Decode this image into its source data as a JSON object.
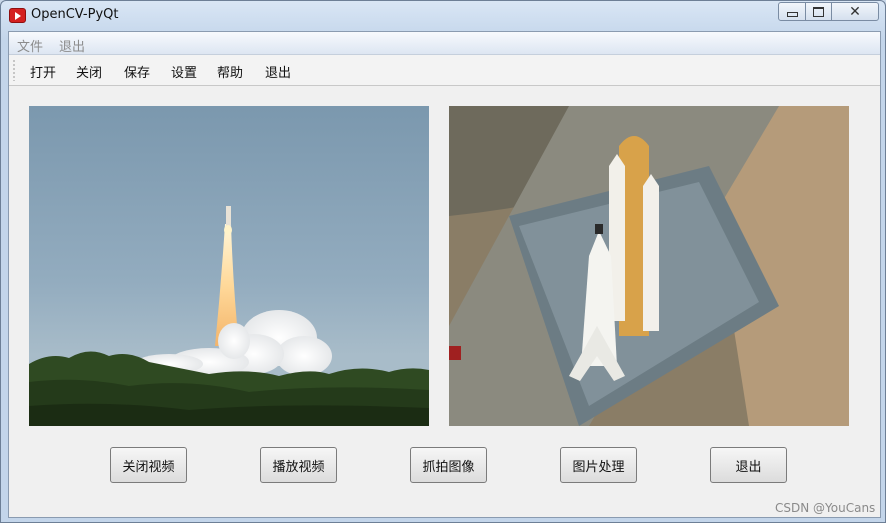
{
  "window": {
    "title": "OpenCV-PyQt",
    "controls": {
      "minimize": "minimize-icon",
      "maximize": "maximize-icon",
      "close": "close-icon"
    }
  },
  "menubar": {
    "items": [
      {
        "label": "文件"
      },
      {
        "label": "退出"
      }
    ]
  },
  "toolbar": {
    "items": [
      {
        "label": "打开"
      },
      {
        "label": "关闭"
      },
      {
        "label": "保存"
      },
      {
        "label": "设置"
      },
      {
        "label": "帮助"
      },
      {
        "label": "退出"
      }
    ]
  },
  "views": {
    "left": {
      "content": "rocket-launch-video-frame"
    },
    "right": {
      "content": "space-shuttle-processed-image"
    }
  },
  "buttons": [
    {
      "label": "关闭视频"
    },
    {
      "label": "播放视频"
    },
    {
      "label": "抓拍图像"
    },
    {
      "label": "图片处理"
    },
    {
      "label": "退出"
    }
  ],
  "watermark": "CSDN @YouCans",
  "colors": {
    "title_bar": "#c9d7e8",
    "client_bg": "#f0f0f0",
    "disabled_text": "#8c8c8c",
    "app_icon": "#d42020"
  }
}
